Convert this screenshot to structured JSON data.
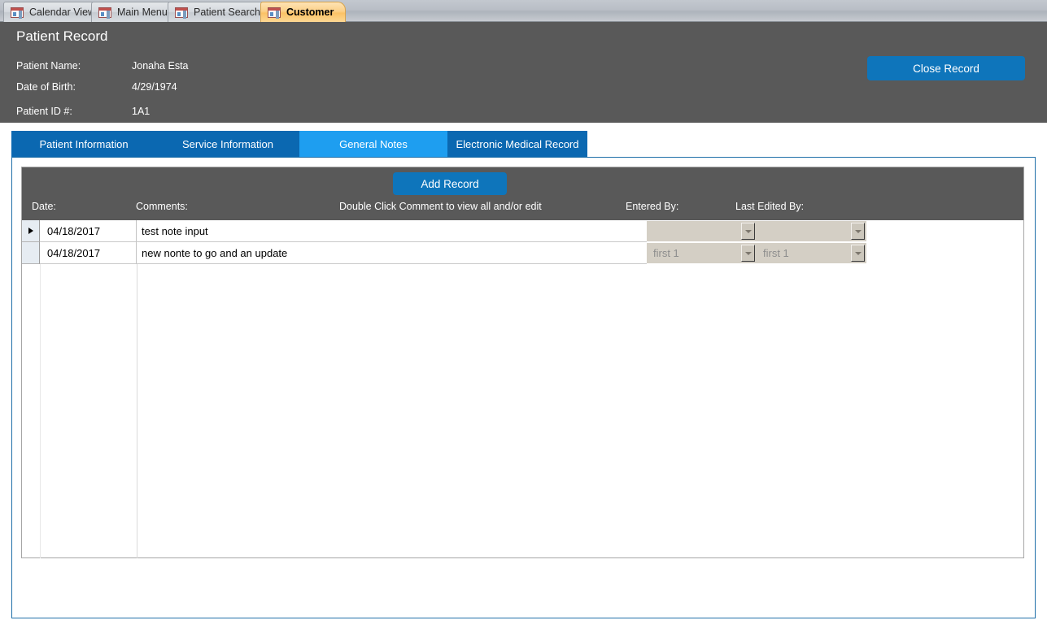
{
  "window": {
    "document_tabs": [
      {
        "label": "Calendar View",
        "icon": "access-form-icon",
        "active": false
      },
      {
        "label": "Main Menu",
        "icon": "access-form-icon",
        "active": false
      },
      {
        "label": "Patient Search",
        "icon": "access-form-icon",
        "active": false
      },
      {
        "label": "Customer",
        "icon": "access-form-icon",
        "active": true
      }
    ]
  },
  "header": {
    "title": "Patient Record",
    "fields": [
      {
        "label": "Patient Name:",
        "value": "Jonaha Esta"
      },
      {
        "label": "Date of Birth:",
        "value": "4/29/1974"
      },
      {
        "label": "Patient ID #:",
        "value": "1A1"
      }
    ],
    "close_button": "Close Record",
    "accent_color": "#0e75bb",
    "background_color": "#595959"
  },
  "section_tabs": {
    "items": [
      {
        "label": "Patient Information",
        "active": false
      },
      {
        "label": "Service Information",
        "active": false
      },
      {
        "label": "General Notes",
        "active": true
      },
      {
        "label": "Electronic Medical Record",
        "active": false
      }
    ],
    "active_color": "#1e9ef0",
    "inactive_color": "#0b68b1"
  },
  "notes_subform": {
    "add_button": "Add Record",
    "columns": {
      "date": "Date:",
      "comments": "Comments:",
      "hint": "Double Click Comment to view all and/or edit",
      "entered_by": "Entered By:",
      "last_edited_by": "Last Edited By:"
    },
    "rows": [
      {
        "selected": true,
        "date": "04/18/2017",
        "comment": "test note input",
        "entered_by": "",
        "last_edited_by": ""
      },
      {
        "selected": false,
        "date": "04/18/2017",
        "comment": "new nonte to go and an update",
        "entered_by": "first 1",
        "last_edited_by": "first 1"
      }
    ]
  }
}
